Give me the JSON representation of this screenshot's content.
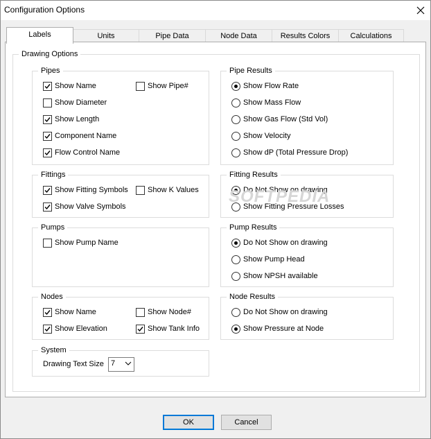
{
  "window": {
    "title": "Configuration Options"
  },
  "tabs": [
    {
      "label": "Labels",
      "active": true
    },
    {
      "label": "Units"
    },
    {
      "label": "Pipe Data"
    },
    {
      "label": "Node Data"
    },
    {
      "label": "Results Colors"
    },
    {
      "label": "Calculations"
    }
  ],
  "drawing_options": {
    "label": "Drawing Options",
    "pipes": {
      "label": "Pipes",
      "items": [
        {
          "label": "Show Name",
          "checked": true
        },
        {
          "label": "Show Pipe#",
          "checked": false
        },
        {
          "label": "Show Diameter",
          "checked": false
        },
        {
          "label": "Show Length",
          "checked": true
        },
        {
          "label": "Component Name",
          "checked": true
        },
        {
          "label": "Flow Control Name",
          "checked": true
        }
      ]
    },
    "fittings": {
      "label": "Fittings",
      "items": [
        {
          "label": "Show Fitting Symbols",
          "checked": true
        },
        {
          "label": "Show K Values",
          "checked": false
        },
        {
          "label": "Show Valve Symbols",
          "checked": true
        }
      ]
    },
    "pumps": {
      "label": "Pumps",
      "items": [
        {
          "label": "Show Pump Name",
          "checked": false
        }
      ]
    },
    "nodes": {
      "label": "Nodes",
      "items": [
        {
          "label": "Show Name",
          "checked": true
        },
        {
          "label": "Show Node#",
          "checked": false
        },
        {
          "label": "Show Elevation",
          "checked": true
        },
        {
          "label": "Show Tank Info",
          "checked": true
        }
      ]
    },
    "system": {
      "label": "System",
      "text_size_label": "Drawing Text Size",
      "text_size_value": "7"
    },
    "pipe_results": {
      "label": "Pipe Results",
      "options": [
        {
          "label": "Show Flow Rate",
          "selected": true
        },
        {
          "label": "Show Mass Flow",
          "selected": false
        },
        {
          "label": "Show Gas Flow (Std Vol)",
          "selected": false
        },
        {
          "label": "Show Velocity",
          "selected": false
        },
        {
          "label": "Show dP (Total Pressure Drop)",
          "selected": false
        }
      ]
    },
    "fitting_results": {
      "label": "Fitting Results",
      "options": [
        {
          "label": "Do Not Show on drawing",
          "selected": true
        },
        {
          "label": "Show Fitting Pressure Losses",
          "selected": false
        }
      ]
    },
    "pump_results": {
      "label": "Pump Results",
      "options": [
        {
          "label": "Do Not Show on drawing",
          "selected": true
        },
        {
          "label": "Show Pump Head",
          "selected": false
        },
        {
          "label": "Show NPSH available",
          "selected": false
        }
      ]
    },
    "node_results": {
      "label": "Node Results",
      "options": [
        {
          "label": "Do Not Show on drawing",
          "selected": false
        },
        {
          "label": "Show Pressure at Node",
          "selected": true
        }
      ]
    }
  },
  "watermark": "SOFTPEDIA",
  "buttons": {
    "ok": "OK",
    "cancel": "Cancel"
  }
}
